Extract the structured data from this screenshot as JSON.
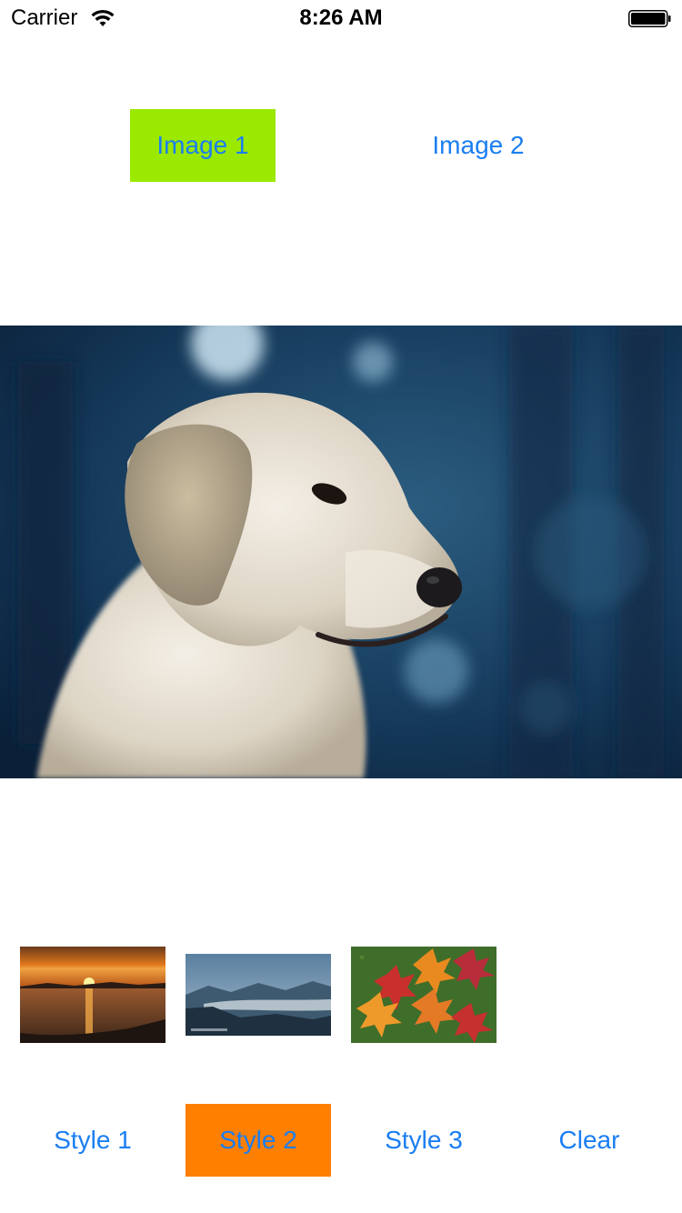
{
  "status_bar": {
    "carrier": "Carrier",
    "time": "8:26 AM",
    "wifi_icon": "wifi-icon",
    "battery_icon": "battery-icon"
  },
  "image_buttons": {
    "image1_label": "Image 1",
    "image2_label": "Image 2",
    "selected": "Image 1",
    "selected_color": "#9be800"
  },
  "main_image": {
    "subject": "golden retriever photo"
  },
  "thumbnails": [
    {
      "name": "sunset over water"
    },
    {
      "name": "misty mountains"
    },
    {
      "name": "autumn maple leaves"
    }
  ],
  "style_buttons": {
    "style1_label": "Style 1",
    "style2_label": "Style 2",
    "style3_label": "Style 3",
    "clear_label": "Clear",
    "selected": "Style 2",
    "selected_color": "#ff7f00"
  },
  "colors": {
    "accent_text": "#1a7ef2"
  }
}
